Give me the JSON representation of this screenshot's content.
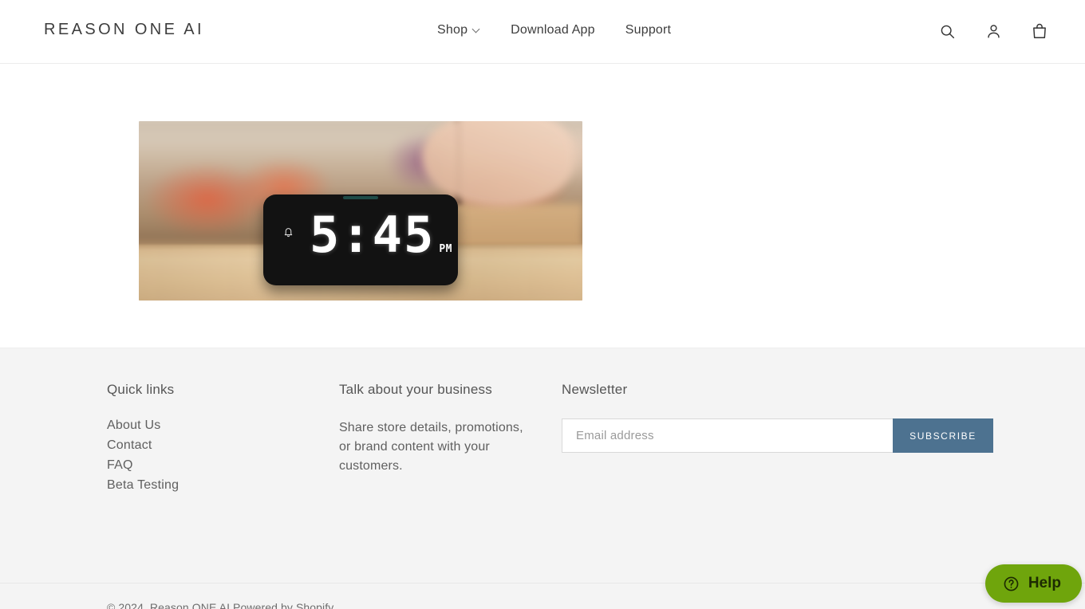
{
  "header": {
    "logo": "REASON ONE AI",
    "nav": [
      {
        "label": "Shop",
        "has_dropdown": true
      },
      {
        "label": "Download App",
        "has_dropdown": false
      },
      {
        "label": "Support",
        "has_dropdown": false
      }
    ],
    "icons": [
      {
        "name": "search-icon",
        "label": "Search"
      },
      {
        "name": "account-icon",
        "label": "Log in"
      },
      {
        "name": "cart-icon",
        "label": "Cart"
      }
    ]
  },
  "main": {
    "product_image": {
      "alt": "Smart alarm clock on a kitchen counter",
      "device": {
        "time": "5:45",
        "meridiem": "PM",
        "alarm_icon": "bell-icon"
      }
    }
  },
  "footer": {
    "quick_links": {
      "heading": "Quick links",
      "items": [
        {
          "label": "About Us"
        },
        {
          "label": "Contact"
        },
        {
          "label": "FAQ"
        },
        {
          "label": "Beta Testing"
        }
      ]
    },
    "about": {
      "heading": "Talk about your business",
      "body": "Share store details, promotions, or brand content with your customers."
    },
    "newsletter": {
      "heading": "Newsletter",
      "email_placeholder": "Email address",
      "email_value": "",
      "subscribe_label": "SUBSCRIBE",
      "button_color": "#4d7290"
    },
    "copyright": "© 2024, Reason ONE AI Powered by Shopify"
  },
  "help_widget": {
    "label": "Help",
    "icon": "question-circle-icon",
    "color": "#6fa50c"
  }
}
